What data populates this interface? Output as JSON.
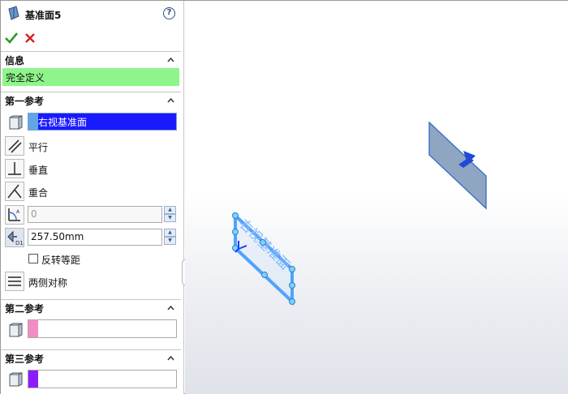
{
  "panel": {
    "title": "基准面5",
    "help_icon": "help-icon",
    "help_glyph": "?",
    "confirm_icon": "check-icon",
    "cancel_icon": "close-icon"
  },
  "info": {
    "header": "信息",
    "status_text": "完全定义",
    "status_color": "#8ef58a"
  },
  "first_ref": {
    "header": "第一参考",
    "selection": "右视基准面",
    "selection_color": "#1a1aff",
    "options": {
      "parallel": "平行",
      "perpendicular": "垂直",
      "coincident": "重合"
    },
    "angle_value": "0",
    "distance_value": "257.50mm",
    "flip_label": "反转等距",
    "flip_checked": false,
    "mid_plane_label": "两侧对称"
  },
  "second_ref": {
    "header": "第二参考",
    "swatch_color": "#f28cc4"
  },
  "third_ref": {
    "header": "第三参考",
    "swatch_color": "#8c1cff"
  },
  "viewport": {
    "plane_label": "右视基准面"
  }
}
